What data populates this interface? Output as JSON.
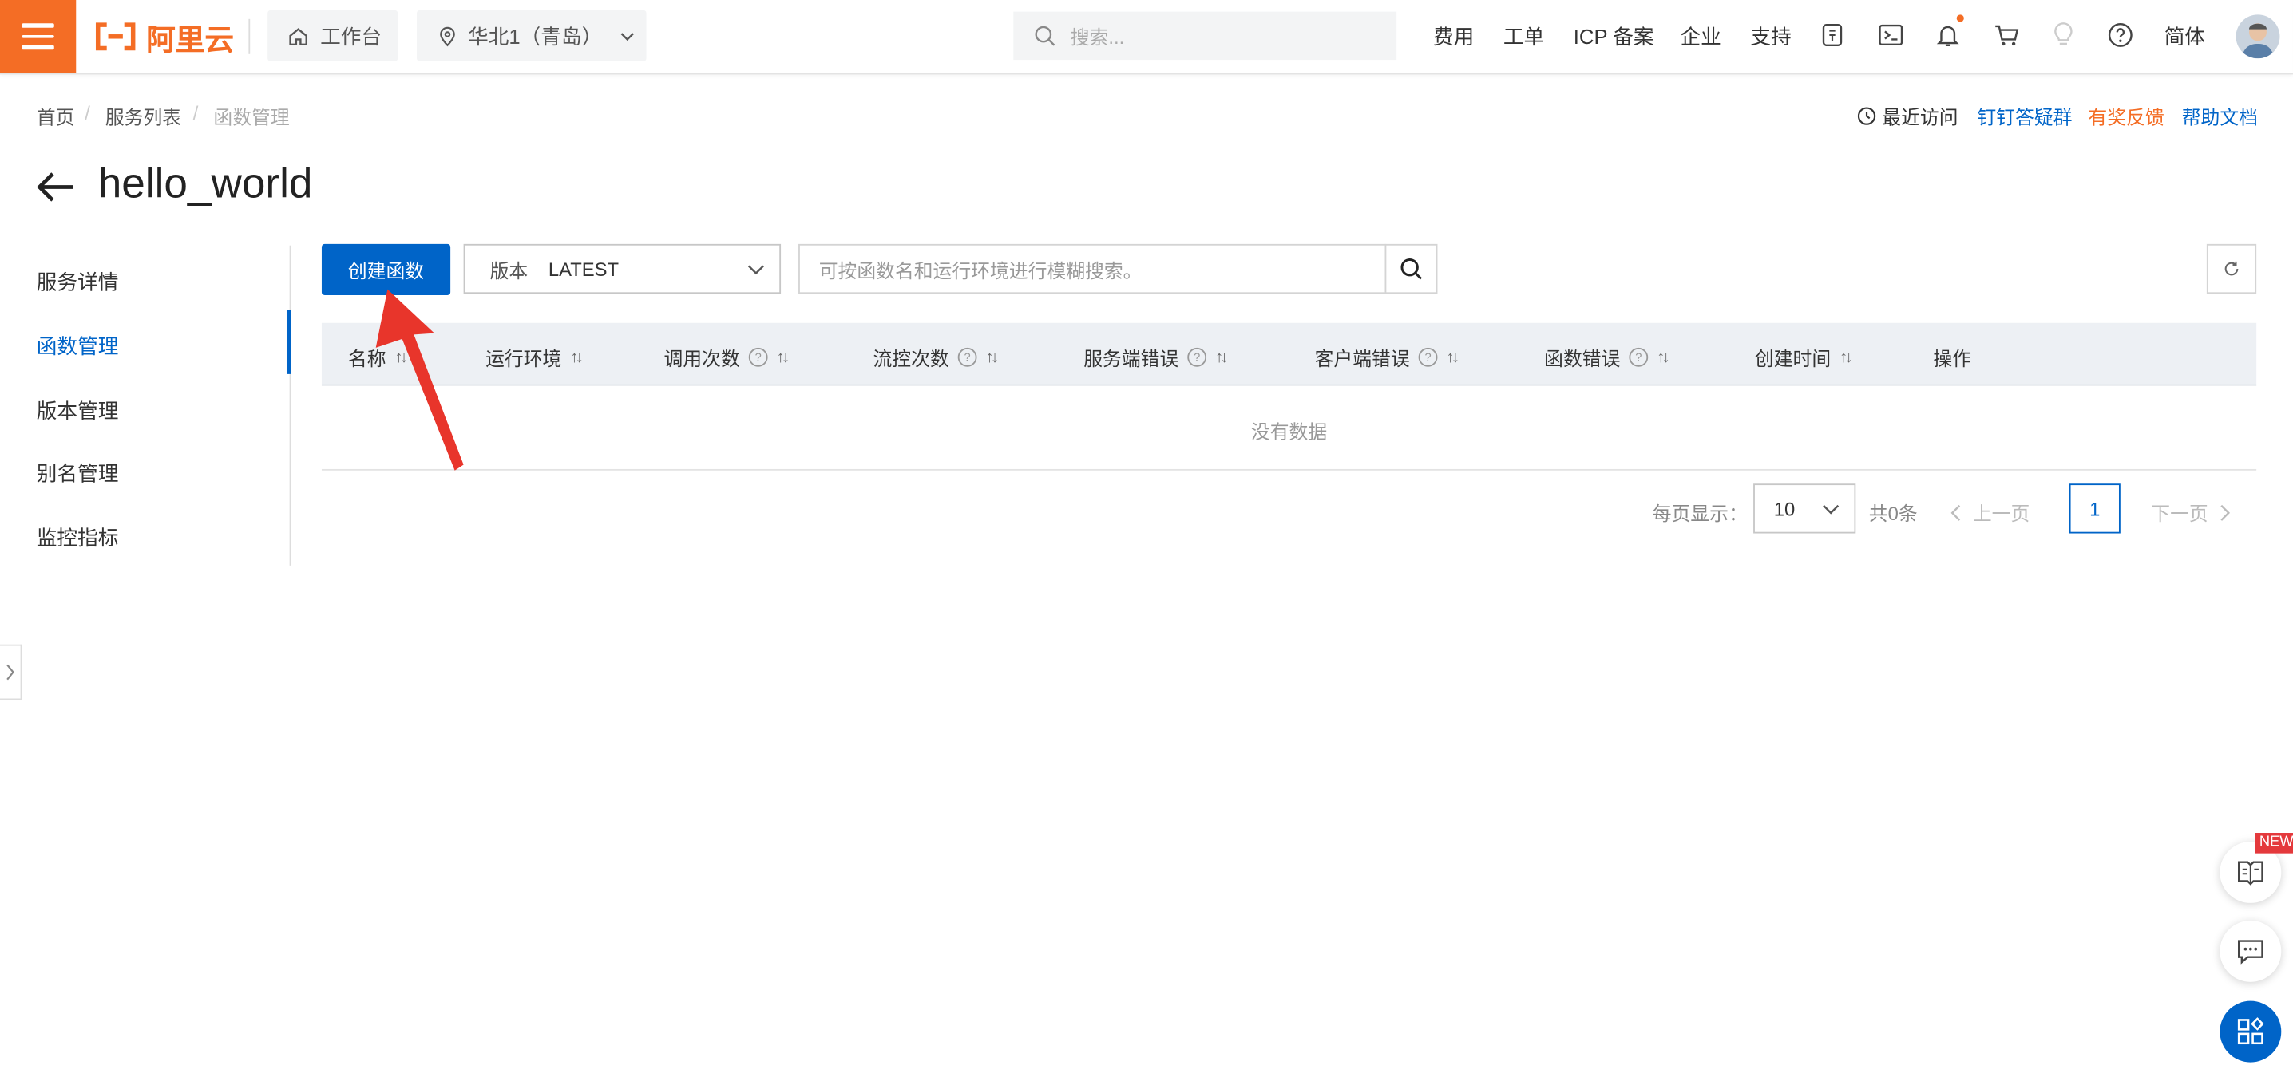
{
  "header": {
    "brand": "阿里云",
    "workbench_label": "工作台",
    "region_label": "华北1（青岛）",
    "search_placeholder": "搜索...",
    "nav": [
      "费用",
      "工单",
      "ICP 备案",
      "企业",
      "支持"
    ],
    "language_label": "简体",
    "accent_color": "#f46d25"
  },
  "breadcrumb": {
    "items": [
      "首页",
      "服务列表",
      "函数管理"
    ],
    "separator": "/"
  },
  "quick_links": {
    "recent": "最近访问",
    "dingtalk": "钉钉答疑群",
    "feedback": "有奖反馈",
    "docs": "帮助文档"
  },
  "page": {
    "title": "hello_world"
  },
  "sidebar": {
    "items": [
      {
        "label": "服务详情"
      },
      {
        "label": "函数管理",
        "active": true
      },
      {
        "label": "版本管理"
      },
      {
        "label": "别名管理"
      },
      {
        "label": "监控指标"
      }
    ]
  },
  "toolbar": {
    "create_label": "创建函数",
    "version_prefix": "版本",
    "version_value": "LATEST",
    "search_placeholder": "可按函数名和运行环境进行模糊搜索。"
  },
  "table": {
    "columns": [
      "名称",
      "运行环境",
      "调用次数",
      "流控次数",
      "服务端错误",
      "客户端错误",
      "函数错误",
      "创建时间",
      "操作"
    ],
    "empty_text": "没有数据"
  },
  "pagination": {
    "page_size_label": "每页显示：",
    "page_size": "10",
    "total_label": "共0条",
    "prev_label": "上一页",
    "current_page": "1",
    "next_label": "下一页"
  },
  "floating": {
    "new_badge": "NEW"
  },
  "colors": {
    "primary": "#0064c8",
    "orange": "#f46d25",
    "annotation_arrow": "#e8352b"
  }
}
